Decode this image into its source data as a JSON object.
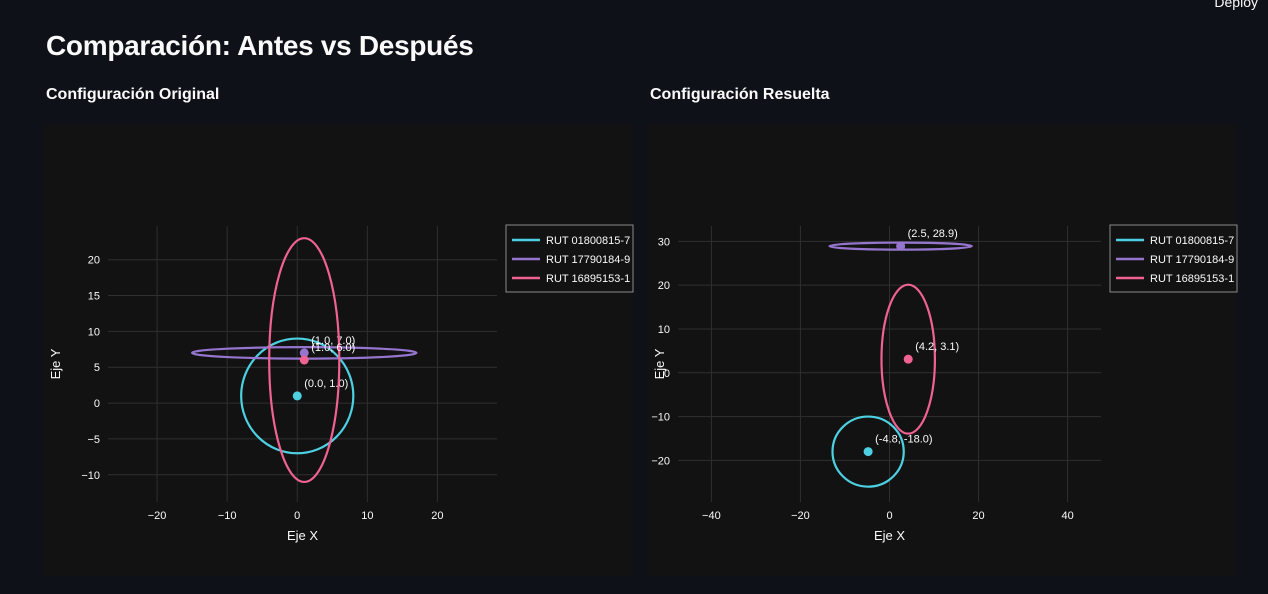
{
  "app": {
    "deploy_label": "Deploy"
  },
  "page": {
    "title": "Comparación: Antes vs Después",
    "left_header": "Configuración Original",
    "right_header": "Configuración Resuelta"
  },
  "colors": {
    "background": "#0e1117",
    "panel": "#121212",
    "grid": "#2f2f2f",
    "text": "#fafafa",
    "series": [
      "#4dd0e1",
      "#9575cd",
      "#f06292"
    ]
  },
  "chart_data": [
    {
      "type": "scatter",
      "title": "",
      "xlabel": "Eje X",
      "ylabel": "Eje Y",
      "xlim": [
        -27,
        28.5
      ],
      "ylim": [
        -13.8,
        24.7
      ],
      "xticks": [
        -20,
        -10,
        0,
        10,
        20
      ],
      "yticks": [
        -10,
        -5,
        0,
        5,
        10,
        15,
        20
      ],
      "grid": true,
      "legend": "top-right outside",
      "series": [
        {
          "name": "RUT 01800815-7",
          "center": [
            0.0,
            1.0
          ],
          "label": "(0.0, 1.0)",
          "radius_x": 8,
          "radius_y": 8
        },
        {
          "name": "RUT 17790184-9",
          "center": [
            1.0,
            7.0
          ],
          "label": "(1.0, 7.0)",
          "radius_x": 16,
          "radius_y": 0.8
        },
        {
          "name": "RUT 16895153-1",
          "center": [
            1.0,
            6.0
          ],
          "label": "(1.0, 6.0)",
          "radius_x": 5,
          "radius_y": 17
        }
      ]
    },
    {
      "type": "scatter",
      "title": "",
      "xlabel": "Eje X",
      "ylabel": "Eje Y",
      "xlim": [
        -47.5,
        47.5
      ],
      "ylim": [
        -29.5,
        33.5
      ],
      "xticks": [
        -40,
        -20,
        0,
        20,
        40
      ],
      "yticks": [
        -20,
        -10,
        0,
        10,
        20,
        30
      ],
      "grid": true,
      "legend": "top-right outside",
      "series": [
        {
          "name": "RUT 01800815-7",
          "center": [
            -4.8,
            -18.0
          ],
          "label": "(-4.8, -18.0)",
          "radius_x": 8,
          "radius_y": 8
        },
        {
          "name": "RUT 17790184-9",
          "center": [
            2.5,
            28.9
          ],
          "label": "(2.5, 28.9)",
          "radius_x": 16,
          "radius_y": 0.8
        },
        {
          "name": "RUT 16895153-1",
          "center": [
            4.2,
            3.1
          ],
          "label": "(4.2, 3.1)",
          "radius_x": 6,
          "radius_y": 17
        }
      ]
    }
  ]
}
